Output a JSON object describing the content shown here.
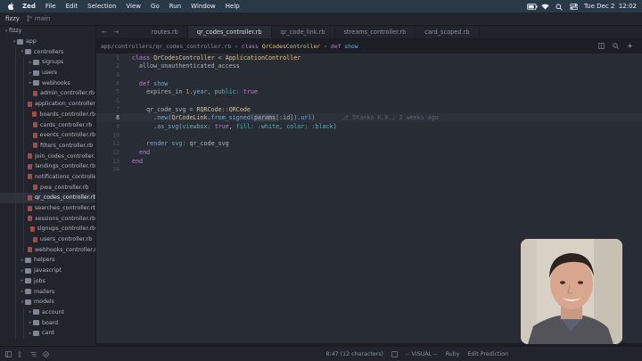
{
  "menubar": {
    "items": [
      "Zed",
      "File",
      "Edit",
      "Selection",
      "View",
      "Go",
      "Run",
      "Window",
      "Help"
    ],
    "datetime": "Tue Dec 2  12:02"
  },
  "titlebar": {
    "project": "fizzy",
    "branch": "main"
  },
  "sidebar": {
    "rows": [
      {
        "label": "fizzy",
        "depth": 0,
        "kind": "root",
        "open": true
      },
      {
        "label": "app",
        "depth": 1,
        "kind": "folder",
        "open": true
      },
      {
        "label": "controllers",
        "depth": 2,
        "kind": "folder",
        "open": true
      },
      {
        "label": "signups",
        "depth": 3,
        "kind": "folder"
      },
      {
        "label": "users",
        "depth": 3,
        "kind": "folder"
      },
      {
        "label": "webhooks",
        "depth": 3,
        "kind": "folder"
      },
      {
        "label": "admin_controller.rb",
        "depth": 3,
        "kind": "rb"
      },
      {
        "label": "application_controller.rb",
        "depth": 3,
        "kind": "rb"
      },
      {
        "label": "boards_controller.rb",
        "depth": 3,
        "kind": "rb"
      },
      {
        "label": "cards_controller.rb",
        "depth": 3,
        "kind": "rb"
      },
      {
        "label": "events_controller.rb",
        "depth": 3,
        "kind": "rb"
      },
      {
        "label": "filters_controller.rb",
        "depth": 3,
        "kind": "rb"
      },
      {
        "label": "join_codes_controller.rb",
        "depth": 3,
        "kind": "rb"
      },
      {
        "label": "landings_controller.rb",
        "depth": 3,
        "kind": "rb"
      },
      {
        "label": "notifications_controller.",
        "depth": 3,
        "kind": "rb"
      },
      {
        "label": "pwa_controller.rb",
        "depth": 3,
        "kind": "rb"
      },
      {
        "label": "qr_codes_controller.rb",
        "depth": 3,
        "kind": "rb",
        "selected": true
      },
      {
        "label": "searches_controller.rb",
        "depth": 3,
        "kind": "rb"
      },
      {
        "label": "sessions_controller.rb",
        "depth": 3,
        "kind": "rb"
      },
      {
        "label": "signups_controller.rb",
        "depth": 3,
        "kind": "rb"
      },
      {
        "label": "users_controller.rb",
        "depth": 3,
        "kind": "rb"
      },
      {
        "label": "webhooks_controller.rb",
        "depth": 3,
        "kind": "rb"
      },
      {
        "label": "helpers",
        "depth": 2,
        "kind": "folder"
      },
      {
        "label": "javascript",
        "depth": 2,
        "kind": "folder"
      },
      {
        "label": "jobs",
        "depth": 2,
        "kind": "folder"
      },
      {
        "label": "mailers",
        "depth": 2,
        "kind": "folder"
      },
      {
        "label": "models",
        "depth": 2,
        "kind": "folder",
        "open": true
      },
      {
        "label": "account",
        "depth": 3,
        "kind": "folder"
      },
      {
        "label": "board",
        "depth": 3,
        "kind": "folder"
      },
      {
        "label": "card",
        "depth": 3,
        "kind": "folder"
      }
    ]
  },
  "tabs": [
    "routes.rb",
    "qr_codes_controller.rb",
    "qr_code_link.rb",
    "streams_controller.rb",
    "card_scoped.rb"
  ],
  "active_tab": 1,
  "breadcrumbs": {
    "path": "app/controllers/qr_codes_controller.rb",
    "sep1": " › ",
    "class_kw": "class",
    "class_name": "QrCodesController",
    "sep2": " › ",
    "def_kw": "def",
    "method": "show"
  },
  "code": {
    "current_line": 8,
    "blame": "Stanko K.R., 2 weeks ago",
    "lines": [
      [
        [
          "kw",
          "class "
        ],
        [
          "ty",
          "QrCodesController"
        ],
        [
          "p",
          " < "
        ],
        [
          "ty",
          "ApplicationController"
        ]
      ],
      [
        [
          "p",
          "  allow_unauthenticated_access"
        ]
      ],
      [],
      [
        [
          "kw",
          "  def "
        ],
        [
          "fn",
          "show"
        ]
      ],
      [
        [
          "p",
          "    expires_in "
        ],
        [
          "num",
          "1"
        ],
        [
          "p",
          "."
        ],
        [
          "fn",
          "year"
        ],
        [
          "p",
          ", "
        ],
        [
          "sym",
          "public:"
        ],
        [
          "p",
          " "
        ],
        [
          "kw",
          "true"
        ]
      ],
      [],
      [
        [
          "p",
          "    qr_code_svg = "
        ],
        [
          "ty",
          "RQRCode"
        ],
        [
          "p",
          "::"
        ],
        [
          "ty",
          "QRCode"
        ]
      ],
      [
        [
          "p",
          "      ."
        ],
        [
          "fn",
          "new"
        ],
        [
          "p",
          "("
        ],
        [
          "ty",
          "QrCodeLink"
        ],
        [
          "p",
          "."
        ],
        [
          "fn",
          "from_signed"
        ],
        [
          "p",
          "("
        ],
        [
          "hl",
          "params"
        ],
        [
          "p",
          "[:id]"
        ],
        [
          "p",
          ")."
        ],
        [
          "fn",
          "url"
        ],
        [
          "p",
          ")"
        ]
      ],
      [
        [
          "p",
          "      ."
        ],
        [
          "fn",
          "as_svg"
        ],
        [
          "p",
          "("
        ],
        [
          "sym",
          "viewbox:"
        ],
        [
          "p",
          " "
        ],
        [
          "kw",
          "true"
        ],
        [
          "p",
          ", "
        ],
        [
          "sym",
          "fill:"
        ],
        [
          "p",
          " "
        ],
        [
          "sym",
          ":white"
        ],
        [
          "p",
          ", "
        ],
        [
          "sym",
          "color:"
        ],
        [
          "p",
          " "
        ],
        [
          "sym",
          ":black"
        ],
        [
          "p",
          ")"
        ]
      ],
      [],
      [
        [
          "p",
          "    "
        ],
        [
          "fn",
          "render"
        ],
        [
          "p",
          " "
        ],
        [
          "sym",
          "svg:"
        ],
        [
          "p",
          " qr_code_svg"
        ]
      ],
      [
        [
          "kw",
          "  end"
        ]
      ],
      [
        [
          "kw",
          "end"
        ]
      ],
      []
    ]
  },
  "statusbar": {
    "cursor": "8:47 (12 characters)",
    "mode": "-- VISUAL --",
    "language": "Ruby",
    "edit_predictions": "Edit Prediction"
  }
}
